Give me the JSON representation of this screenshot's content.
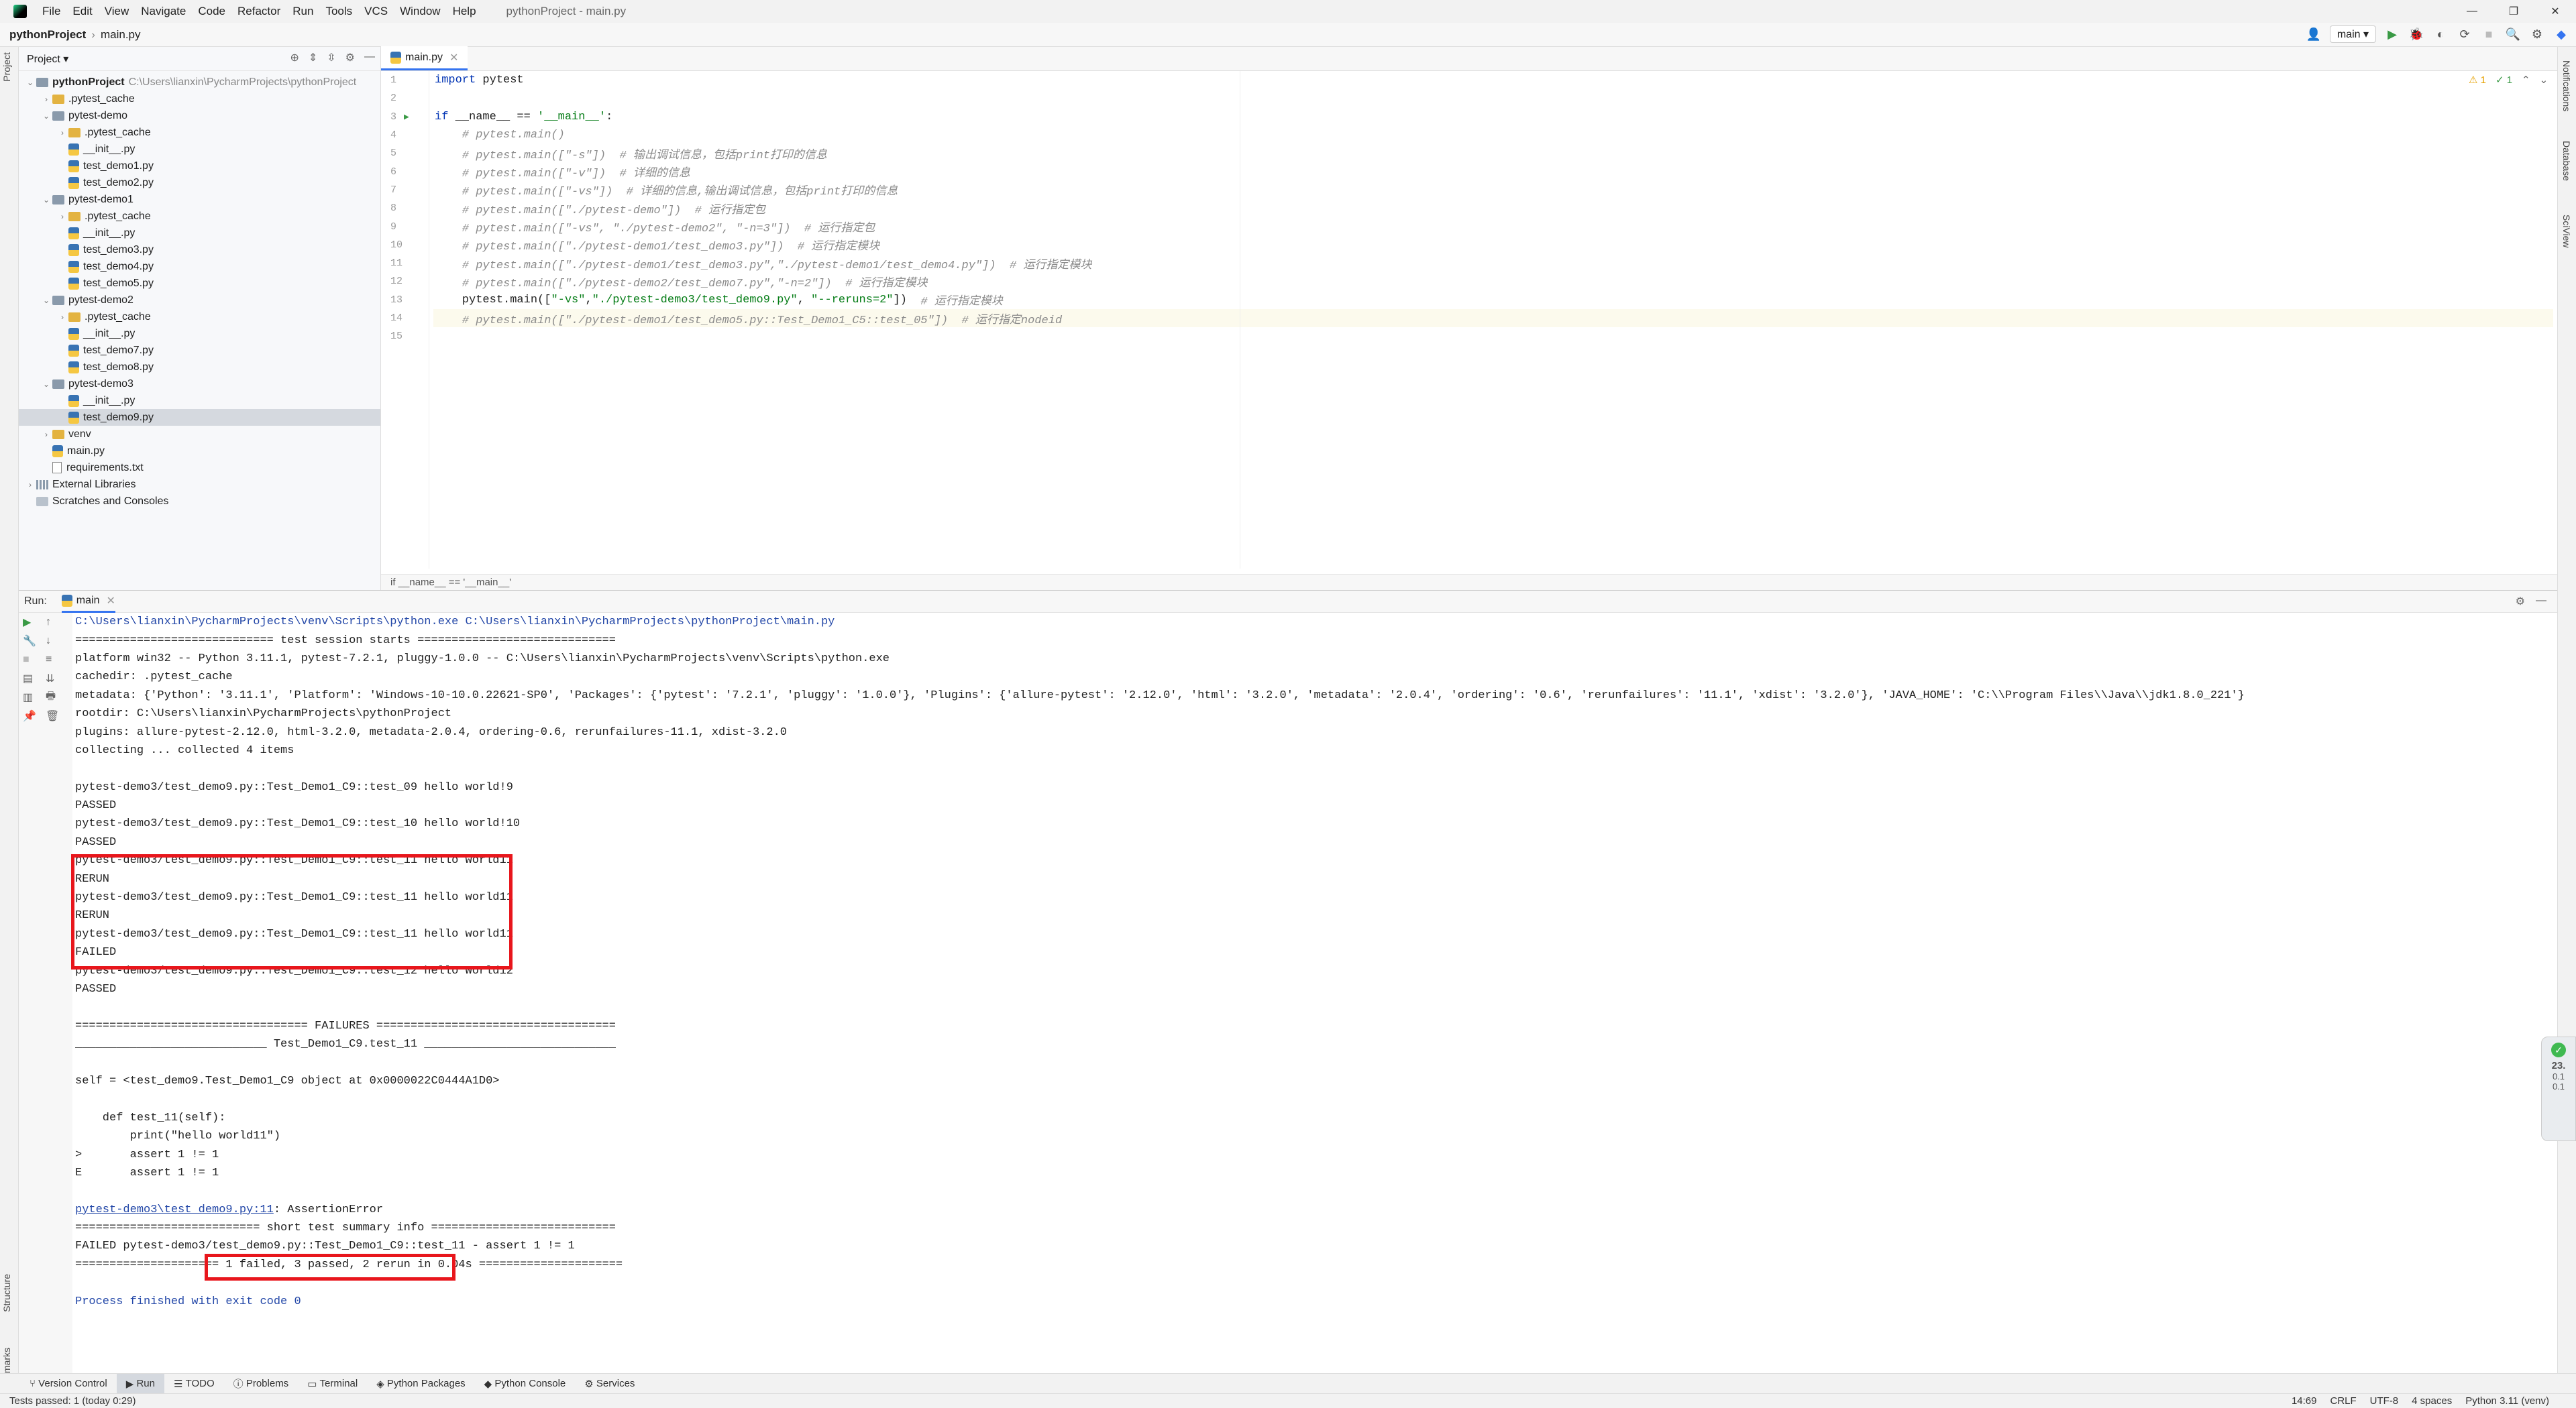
{
  "app": {
    "window_title": "pythonProject - main.py",
    "menu": [
      "File",
      "Edit",
      "View",
      "Navigate",
      "Code",
      "Refactor",
      "Run",
      "Tools",
      "VCS",
      "Window",
      "Help"
    ],
    "window_controls": [
      "—",
      "❐",
      "✕"
    ]
  },
  "navbar": {
    "project": "pythonProject",
    "file": "main.py",
    "run_config": "main ▾"
  },
  "project_panel": {
    "title": "Project ▾",
    "tree": [
      {
        "label": "pythonProject",
        "hint": "C:\\Users\\lianxin\\PycharmProjects\\pythonProject",
        "depth": 0,
        "kind": "folder",
        "open": true,
        "bold": true
      },
      {
        "label": ".pytest_cache",
        "depth": 1,
        "kind": "folder-y",
        "open": false
      },
      {
        "label": "pytest-demo",
        "depth": 1,
        "kind": "folder",
        "open": true
      },
      {
        "label": ".pytest_cache",
        "depth": 2,
        "kind": "folder-y",
        "open": false
      },
      {
        "label": "__init__.py",
        "depth": 2,
        "kind": "py"
      },
      {
        "label": "test_demo1.py",
        "depth": 2,
        "kind": "py"
      },
      {
        "label": "test_demo2.py",
        "depth": 2,
        "kind": "py"
      },
      {
        "label": "pytest-demo1",
        "depth": 1,
        "kind": "folder",
        "open": true
      },
      {
        "label": ".pytest_cache",
        "depth": 2,
        "kind": "folder-y",
        "open": false
      },
      {
        "label": "__init__.py",
        "depth": 2,
        "kind": "py"
      },
      {
        "label": "test_demo3.py",
        "depth": 2,
        "kind": "py"
      },
      {
        "label": "test_demo4.py",
        "depth": 2,
        "kind": "py"
      },
      {
        "label": "test_demo5.py",
        "depth": 2,
        "kind": "py"
      },
      {
        "label": "pytest-demo2",
        "depth": 1,
        "kind": "folder",
        "open": true
      },
      {
        "label": ".pytest_cache",
        "depth": 2,
        "kind": "folder-y",
        "open": false
      },
      {
        "label": "__init__.py",
        "depth": 2,
        "kind": "py"
      },
      {
        "label": "test_demo7.py",
        "depth": 2,
        "kind": "py"
      },
      {
        "label": "test_demo8.py",
        "depth": 2,
        "kind": "py"
      },
      {
        "label": "pytest-demo3",
        "depth": 1,
        "kind": "folder",
        "open": true
      },
      {
        "label": "__init__.py",
        "depth": 2,
        "kind": "py"
      },
      {
        "label": "test_demo9.py",
        "depth": 2,
        "kind": "py",
        "selected": true
      },
      {
        "label": "venv",
        "depth": 1,
        "kind": "folder-y",
        "open": false
      },
      {
        "label": "main.py",
        "depth": 1,
        "kind": "py"
      },
      {
        "label": "requirements.txt",
        "depth": 1,
        "kind": "txt"
      },
      {
        "label": "External Libraries",
        "depth": 0,
        "kind": "lib",
        "open": false
      },
      {
        "label": "Scratches and Consoles",
        "depth": 0,
        "kind": "scratch"
      }
    ]
  },
  "editor": {
    "tab": "main.py",
    "lines": [
      [
        [
          "kw",
          "import"
        ],
        [
          "fn",
          " pytest"
        ]
      ],
      [],
      [
        [
          "kw",
          "if"
        ],
        [
          "fn",
          " __name__ == "
        ],
        [
          "st",
          "'__main__'"
        ],
        [
          "fn",
          ":"
        ]
      ],
      [
        [
          "cm",
          "    # pytest.main()"
        ]
      ],
      [
        [
          "cm",
          "    # pytest.main([\"-s\"])  # 输出调试信息，包括print打印的信息"
        ]
      ],
      [
        [
          "cm",
          "    # pytest.main([\"-v\"])  # 详细的信息"
        ]
      ],
      [
        [
          "cm",
          "    # pytest.main([\"-vs\"])  # 详细的信息,输出调试信息，包括print打印的信息"
        ]
      ],
      [
        [
          "cm",
          "    # pytest.main([\"./pytest-demo\"])  # 运行指定包"
        ]
      ],
      [
        [
          "cm",
          "    # pytest.main([\"-vs\", \"./pytest-demo2\", \"-n=3\"])  # 运行指定包"
        ]
      ],
      [
        [
          "cm",
          "    # pytest.main([\"./pytest-demo1/test_demo3.py\"])  # 运行指定模块"
        ]
      ],
      [
        [
          "cm",
          "    # pytest.main([\"./pytest-demo1/test_demo3.py\",\"./pytest-demo1/test_demo4.py\"])  # 运行指定模块"
        ]
      ],
      [
        [
          "cm",
          "    # pytest.main([\"./pytest-demo2/test_demo7.py\",\"-n=2\"])  # 运行指定模块"
        ]
      ],
      [
        [
          "fn",
          "    pytest.main(["
        ],
        [
          "st",
          "\"-vs\""
        ],
        [
          "fn",
          ","
        ],
        [
          "st",
          "\"./pytest-demo3/test_demo9.py\""
        ],
        [
          "fn",
          ", "
        ],
        [
          "st",
          "\"--reruns=2\""
        ],
        [
          "fn",
          "])  "
        ],
        [
          "cm",
          "# 运行指定模块"
        ]
      ],
      [
        [
          "cm",
          "    # pytest.main([\"./pytest-demo1/test_demo5.py::Test_Demo1_C5::test_05\"])  # 运行指定nodeid"
        ]
      ],
      []
    ],
    "breadcrumb": "if __name__ == '__main__'",
    "inspections": [
      "⚠ 1",
      "✓ 1",
      "⌃",
      "⌄"
    ]
  },
  "run_panel": {
    "label": "Run:",
    "tab": "main",
    "console": [
      {
        "t": "C:\\Users\\lianxin\\PycharmProjects\\venv\\Scripts\\python.exe C:\\Users\\lianxin\\PycharmProjects\\pythonProject\\main.py",
        "c": "blue"
      },
      {
        "t": "============================= test session starts ============================="
      },
      {
        "t": "platform win32 -- Python 3.11.1, pytest-7.2.1, pluggy-1.0.0 -- C:\\Users\\lianxin\\PycharmProjects\\venv\\Scripts\\python.exe"
      },
      {
        "t": "cachedir: .pytest_cache"
      },
      {
        "t": "metadata: {'Python': '3.11.1', 'Platform': 'Windows-10-10.0.22621-SP0', 'Packages': {'pytest': '7.2.1', 'pluggy': '1.0.0'}, 'Plugins': {'allure-pytest': '2.12.0', 'html': '3.2.0', 'metadata': '2.0.4', 'ordering': '0.6', 'rerunfailures': '11.1', 'xdist': '3.2.0'}, 'JAVA_HOME': 'C:\\\\Program Files\\\\Java\\\\jdk1.8.0_221'}"
      },
      {
        "t": "rootdir: C:\\Users\\lianxin\\PycharmProjects\\pythonProject"
      },
      {
        "t": "plugins: allure-pytest-2.12.0, html-3.2.0, metadata-2.0.4, ordering-0.6, rerunfailures-11.1, xdist-3.2.0"
      },
      {
        "t": "collecting ... collected 4 items"
      },
      {
        "t": ""
      },
      {
        "t": "pytest-demo3/test_demo9.py::Test_Demo1_C9::test_09 hello world!9"
      },
      {
        "t": "PASSED"
      },
      {
        "t": "pytest-demo3/test_demo9.py::Test_Demo1_C9::test_10 hello world!10"
      },
      {
        "t": "PASSED"
      },
      {
        "t": "pytest-demo3/test_demo9.py::Test_Demo1_C9::test_11 hello world11"
      },
      {
        "t": "RERUN"
      },
      {
        "t": "pytest-demo3/test_demo9.py::Test_Demo1_C9::test_11 hello world11"
      },
      {
        "t": "RERUN"
      },
      {
        "t": "pytest-demo3/test_demo9.py::Test_Demo1_C9::test_11 hello world11"
      },
      {
        "t": "FAILED"
      },
      {
        "t": "pytest-demo3/test_demo9.py::Test_Demo1_C9::test_12 hello world12"
      },
      {
        "t": "PASSED"
      },
      {
        "t": ""
      },
      {
        "t": "================================== FAILURES ==================================="
      },
      {
        "t": "____________________________ Test_Demo1_C9.test_11 ____________________________"
      },
      {
        "t": ""
      },
      {
        "t": "self = <test_demo9.Test_Demo1_C9 object at 0x0000022C0444A1D0>"
      },
      {
        "t": ""
      },
      {
        "t": "    def test_11(self):"
      },
      {
        "t": "        print(\"hello world11\")"
      },
      {
        "t": ">       assert 1 != 1"
      },
      {
        "t": "E       assert 1 != 1"
      },
      {
        "t": ""
      },
      {
        "t": "pytest-demo3\\test_demo9.py:11",
        "tail": ": AssertionError",
        "link": true
      },
      {
        "t": "=========================== short test summary info ==========================="
      },
      {
        "t": "FAILED pytest-demo3/test_demo9.py::Test_Demo1_C9::test_11 - assert 1 != 1"
      },
      {
        "t": "===================== 1 failed, 3 passed, 2 rerun in 0.04s ====================="
      },
      {
        "t": ""
      },
      {
        "t": "Process finished with exit code 0",
        "c": "blue"
      }
    ]
  },
  "left_strip": {
    "top": "Project",
    "structure": "Structure",
    "bookmarks": "Bookmarks"
  },
  "right_strip": {
    "notifications": "Notifications",
    "database": "Database",
    "sciview": "SciView"
  },
  "bottom_tabs": [
    "Version Control",
    "Run",
    "TODO",
    "Problems",
    "Terminal",
    "Python Packages",
    "Python Console",
    "Services"
  ],
  "status": {
    "left": "Tests passed: 1 (today 0:29)",
    "position": "14:69",
    "line_sep": "CRLF",
    "encoding": "UTF-8",
    "indent": "4 spaces",
    "interpreter": "Python 3.11 (venv)"
  },
  "memory_widget": {
    "value": "23.",
    "a": "0.1",
    "b": "0.1"
  }
}
